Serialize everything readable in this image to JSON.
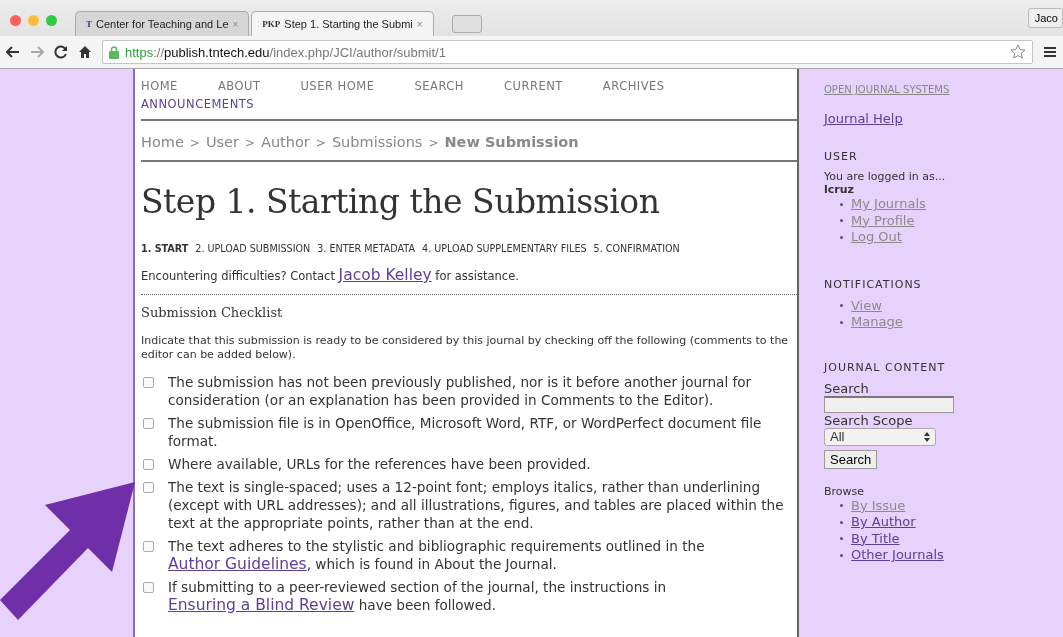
{
  "browser": {
    "tabs": [
      {
        "favicon": "T",
        "title": "Center for Teaching and Le",
        "selected": false
      },
      {
        "favicon": "PKP",
        "title": "Step 1. Starting the Submi",
        "selected": true
      }
    ],
    "tab_close": "×",
    "profile": "Jaco",
    "url": {
      "scheme": "https",
      "sep": "://",
      "host": "publish.tntech.edu",
      "path": "/index.php/JCI/author/submit/1"
    }
  },
  "nav": [
    {
      "label": "HOME",
      "visited": true
    },
    {
      "label": "ABOUT",
      "visited": true
    },
    {
      "label": "USER HOME",
      "visited": true
    },
    {
      "label": "SEARCH",
      "visited": true
    },
    {
      "label": "CURRENT",
      "visited": true
    },
    {
      "label": "ARCHIVES",
      "visited": true
    },
    {
      "label": "ANNOUNCEMENTS",
      "visited": false
    }
  ],
  "breadcrumb": [
    {
      "label": "Home",
      "current": false
    },
    {
      "label": "User",
      "current": false
    },
    {
      "label": "Author",
      "current": false
    },
    {
      "label": "Submissions",
      "current": false
    },
    {
      "label": "New Submission",
      "current": true
    }
  ],
  "breadcrumb_separator": ">",
  "title": "Step 1. Starting the Submission",
  "steps": [
    {
      "label": "1. START",
      "selected": true
    },
    {
      "label": "2. UPLOAD SUBMISSION",
      "selected": false
    },
    {
      "label": "3. ENTER METADATA",
      "selected": false
    },
    {
      "label": "4. UPLOAD SUPPLEMENTARY FILES",
      "selected": false
    },
    {
      "label": "5. CONFIRMATION",
      "selected": false
    }
  ],
  "help": {
    "before": "Encountering difficulties? Contact",
    "link": "Jacob Kelley",
    "after": "for assistance."
  },
  "checklist": {
    "heading": "Submission Checklist",
    "intro": "Indicate that this submission is ready to be considered by this journal by checking off the following (comments to the editor can be added below).",
    "items": [
      {
        "checked": false,
        "text": "The submission has not been previously published, nor is it before another journal for consideration (or an explanation has been provided in Comments to the Editor)."
      },
      {
        "checked": false,
        "text": "The submission file is in OpenOffice, Microsoft Word, RTF, or WordPerfect document file format."
      },
      {
        "checked": false,
        "text": "Where available, URLs for the references have been provided."
      },
      {
        "checked": false,
        "text": "The text is single-spaced; uses a 12-point font; employs italics, rather than underlining (except with URL addresses); and all illustrations, figures, and tables are placed within the text at the appropriate points, rather than at the end."
      },
      {
        "checked": false,
        "text": "The text adheres to the stylistic and bibliographic requirements outlined in the",
        "link": "Author Guidelines",
        "after": ", which is found in About the Journal."
      },
      {
        "checked": false,
        "text": "If submitting to a peer-reviewed section of the journal, the instructions in",
        "link": "Ensuring a Blind Review",
        "after": " have been followed."
      }
    ]
  },
  "sidebar": {
    "ojs": "OPEN JOURNAL SYSTEMS",
    "help": "Journal Help",
    "user": {
      "heading": "USER",
      "logged": "You are logged in as...",
      "username": "lcruz",
      "links": [
        {
          "label": "My Journals",
          "visited": true
        },
        {
          "label": "My Profile",
          "visited": true
        },
        {
          "label": "Log Out",
          "visited": true
        }
      ]
    },
    "notifications": {
      "heading": "NOTIFICATIONS",
      "links": [
        {
          "label": "View",
          "visited": true
        },
        {
          "label": "Manage",
          "visited": true
        }
      ]
    },
    "content": {
      "heading": "JOURNAL CONTENT",
      "search_label": "Search",
      "scope_label": "Search Scope",
      "scope_value": "All",
      "button": "Search",
      "browse": "Browse",
      "links": [
        {
          "label": "By Issue",
          "visited": true
        },
        {
          "label": "By Author",
          "visited": false
        },
        {
          "label": "By Title",
          "visited": false
        },
        {
          "label": "Other Journals",
          "visited": false
        }
      ]
    }
  }
}
